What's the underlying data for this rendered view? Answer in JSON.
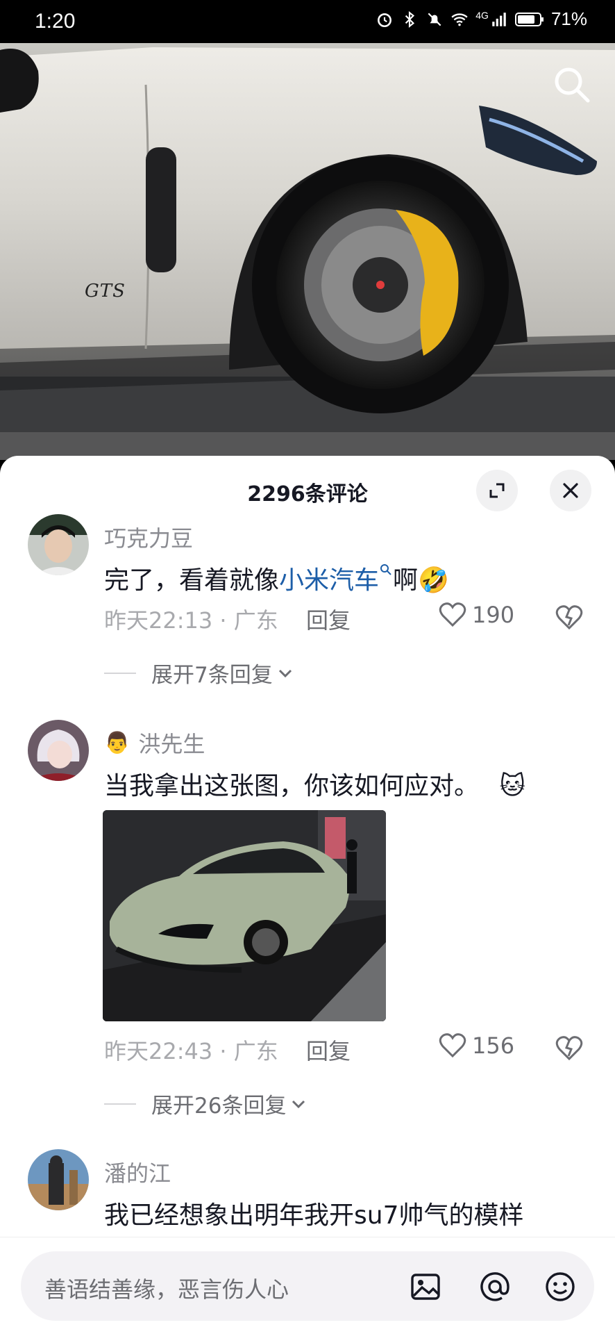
{
  "status": {
    "time": "1:20",
    "battery": "71%",
    "network": "4G"
  },
  "video": {
    "car_badge": "GTS"
  },
  "sheet": {
    "title": "2296条评论"
  },
  "comments": [
    {
      "name": "巧克力豆",
      "text_before": "完了，看着就像",
      "link_text": "小米汽车",
      "text_after": "啊",
      "emoji": "🤣",
      "time": "昨天22:13",
      "location": "广东",
      "reply": "回复",
      "likes": "190",
      "expand": "展开7条回复"
    },
    {
      "name": "洪先生",
      "badge_emoji": "👨",
      "text": "当我拿出这张图，你该如何应对。",
      "emoji": "🐱",
      "time": "昨天22:43",
      "location": "广东",
      "reply": "回复",
      "likes": "156",
      "expand": "展开26条回复"
    },
    {
      "name": "潘的江",
      "text": "我已经想象出明年我开su7帅气的模样"
    }
  ],
  "input": {
    "placeholder": "善语结善缘，恶言伤人心"
  },
  "colors": {
    "link": "#1d5ea8",
    "caliper": "#e8b21a",
    "car_body": "#d8d6d0"
  }
}
